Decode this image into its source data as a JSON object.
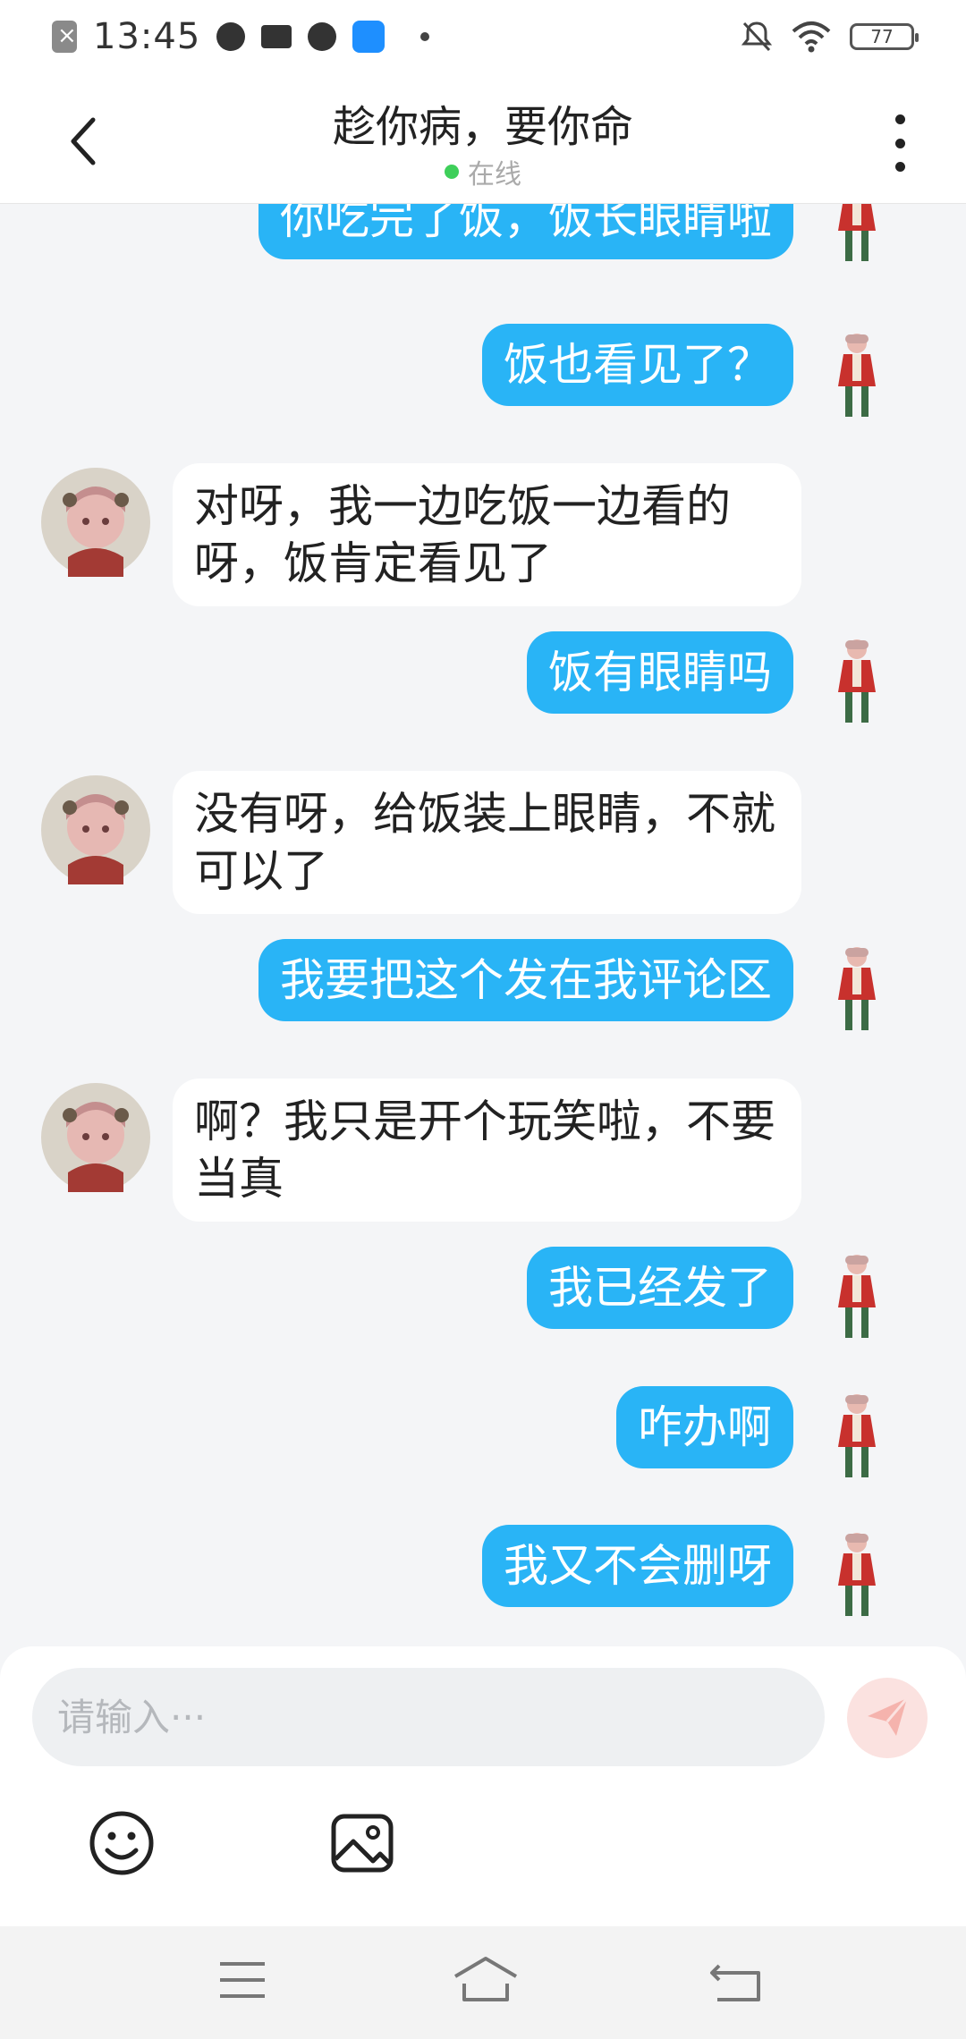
{
  "status_bar": {
    "time": "13:45",
    "battery": "77",
    "icons": [
      "app-close-icon",
      "speedometer-icon",
      "book-icon",
      "bird-icon",
      "hotspot-icon",
      "dot-icon",
      "mute-icon",
      "wifi-icon",
      "battery-icon"
    ]
  },
  "header": {
    "title": "趁你病，要你命",
    "status": "在线",
    "status_color": "#3ecf5a",
    "back_icon": "chevron-left-icon",
    "menu_icon": "more-vertical-icon"
  },
  "messages": [
    {
      "from": "me",
      "text": "你吃完了饭，饭长眼睛啦"
    },
    {
      "from": "me",
      "text": "饭也看见了？"
    },
    {
      "from": "them",
      "text": "对呀，我一边吃饭一边看的呀，饭肯定看见了"
    },
    {
      "from": "me",
      "text": "饭有眼睛吗"
    },
    {
      "from": "them",
      "text": "没有呀，给饭装上眼睛，不就可以了"
    },
    {
      "from": "me",
      "text": "我要把这个发在我评论区"
    },
    {
      "from": "them",
      "text": "啊？我只是开个玩笑啦，不要当真"
    },
    {
      "from": "me",
      "text": "我已经发了"
    },
    {
      "from": "me",
      "text": "咋办啊"
    },
    {
      "from": "me",
      "text": "我又不会删呀"
    }
  ],
  "composer": {
    "placeholder": "请输入···",
    "send_icon": "paper-plane-icon",
    "tools": [
      "emoji-icon",
      "image-icon"
    ]
  },
  "nav": [
    "menu-icon",
    "home-icon",
    "back-icon"
  ],
  "colors": {
    "my_bubble": "#29b4f6",
    "their_bubble": "#ffffff",
    "background": "#f4f5f7"
  }
}
